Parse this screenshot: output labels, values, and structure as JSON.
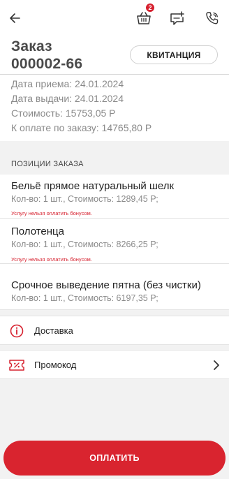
{
  "header": {
    "cart_badge": "2",
    "order_title_line1": "Заказ",
    "order_title_line2": "000002-66",
    "receipt_label": "КВИТАНЦИЯ"
  },
  "order_info": [
    "Дата приема: 24.01.2024",
    "Дата выдачи: 24.01.2024",
    "Стоимость: 15753,05 Р",
    "К оплате по заказу: 14765,80 Р"
  ],
  "positions": {
    "section_label": "ПОЗИЦИИ ЗАКАЗА",
    "items": [
      {
        "name": "Бельё прямое натуральный шелк",
        "details": "Кол-во: 1 шт., Стоимость: 1289,45 Р;",
        "warning": "Услугу нельзя оплатить бонусом."
      },
      {
        "name": "Полотенца",
        "details": "Кол-во: 1 шт., Стоимость: 8266,25 Р;",
        "warning": "Услугу нельзя оплатить бонусом."
      },
      {
        "name": "Срочное выведение пятна (без чистки)",
        "details": "Кол-во: 1 шт., Стоимость: 6197,35 Р;",
        "warning": ""
      }
    ]
  },
  "rows": {
    "delivery_label": "Доставка",
    "promo_label": "Промокод"
  },
  "pay_button_label": "ОПЛАТИТЬ",
  "colors": {
    "accent": "#d9242f",
    "muted_text": "#8a8a8a",
    "band": "#f2f2f2"
  },
  "icons": {
    "back": "arrow-left-icon",
    "cart": "basket-icon",
    "chat": "chat-plus-icon",
    "phone": "phone-icon",
    "delivery": "info-circle-icon",
    "promo": "ticket-percent-icon",
    "chevron": "chevron-right-icon"
  }
}
